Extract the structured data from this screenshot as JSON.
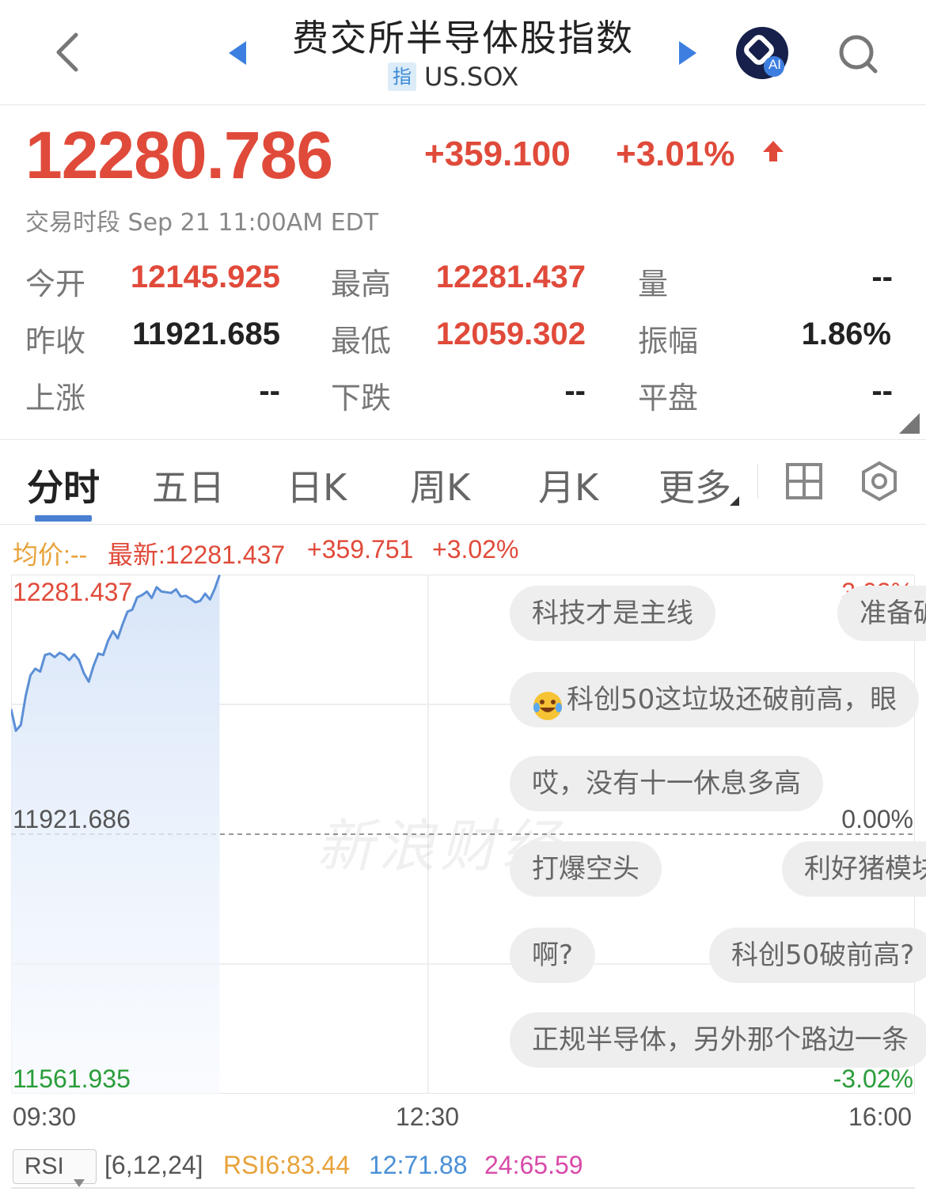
{
  "header": {
    "title": "费交所半导体股指数",
    "badge": "指",
    "symbol": "US.SOX",
    "ai_label": "AI"
  },
  "quote": {
    "price": "12280.786",
    "change": "+359.100",
    "change_pct": "+3.01%",
    "session": "交易时段 Sep 21 11:00AM EDT"
  },
  "stats": [
    {
      "label": "今开",
      "value": "12145.925"
    },
    {
      "label": "最高",
      "value": "12281.437"
    },
    {
      "label": "量",
      "value": "--"
    },
    {
      "label": "昨收",
      "value": "11921.685"
    },
    {
      "label": "最低",
      "value": "12059.302"
    },
    {
      "label": "振幅",
      "value": "1.86%"
    },
    {
      "label": "上涨",
      "value": "--"
    },
    {
      "label": "下跌",
      "value": "--"
    },
    {
      "label": "平盘",
      "value": "--"
    }
  ],
  "tabs": [
    "分时",
    "五日",
    "日K",
    "周K",
    "月K",
    "更多"
  ],
  "chart_info": {
    "avg": "均价:--",
    "latest": "最新:12281.437",
    "change": "+359.751",
    "change_pct": "+3.02%"
  },
  "chart_data": {
    "type": "line",
    "title": "",
    "xlabel": "",
    "ylabel": "",
    "x_ticks": [
      "09:30",
      "12:30",
      "16:00"
    ],
    "ylim": [
      11561.935,
      12281.437
    ],
    "y_ticks_left": [
      "12281.437",
      "11921.686",
      "11561.935"
    ],
    "y_ticks_right": [
      "3.02%",
      "0.00%",
      "-3.02%"
    ],
    "reference": 11921.686,
    "series": [
      {
        "values": [
          12095,
          12065,
          12073,
          12113,
          12142,
          12151,
          12147,
          12170,
          12172,
          12167,
          12173,
          12170,
          12163,
          12171,
          12163,
          12145,
          12133,
          12155,
          12172,
          12170,
          12190,
          12203,
          12193,
          12213,
          12230,
          12233,
          12250,
          12253,
          12258,
          12249,
          12264,
          12258,
          12257,
          12256,
          12261,
          12251,
          12252,
          12248,
          12243,
          12245,
          12255,
          12247,
          12262,
          12281
        ]
      }
    ]
  },
  "comments": [
    "科技才是主线",
    "准备破",
    "科创50这垃圾还破前高，眼",
    "哎，没有十一休息多高",
    "打爆空头",
    "利好猪模块",
    "啊?",
    "科创50破前高?",
    "正规半导体，另外那个路边一条"
  ],
  "watermark": "新浪财经",
  "rsi": {
    "selector": "RSI",
    "params": "[6,12,24]",
    "rsi6": "RSI6:83.44",
    "rsi12": "12:71.88",
    "rsi24": "24:65.59"
  },
  "colors": {
    "up": "#e04a3a",
    "down": "#2a9d3a",
    "line": "#5b8fd6",
    "avg": "#e8a23a",
    "rsi12": "#4a8fd6",
    "rsi24": "#d84aa8",
    "tab_underline": "#4a7fd4"
  }
}
